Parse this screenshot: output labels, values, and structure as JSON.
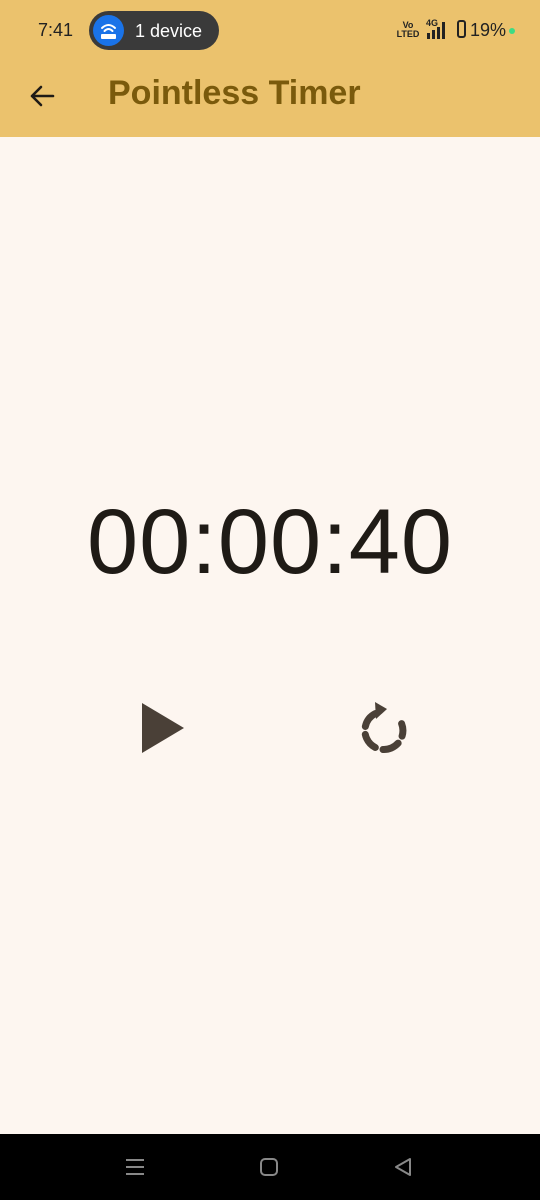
{
  "status_bar": {
    "time": "7:41",
    "hotspot_label": "1 device",
    "volte_top": "Vo",
    "volte_bottom": "LTED",
    "network": "4G",
    "battery": "19%"
  },
  "app_bar": {
    "title": "Pointless Timer",
    "back_icon": "arrow-left-icon"
  },
  "timer": {
    "display": "00:00:40"
  },
  "controls": {
    "play_icon": "play-icon",
    "reset_icon": "replay-icon"
  },
  "navigation_bar": {
    "buttons": [
      "recents",
      "home",
      "back"
    ]
  },
  "colors": {
    "app_bar_background": "#ebc26d",
    "title_text": "#7a5a0c",
    "page_background": "#fdf6f0",
    "control_icons": "#4a4037",
    "hotspot_accent": "#1a73e8"
  }
}
